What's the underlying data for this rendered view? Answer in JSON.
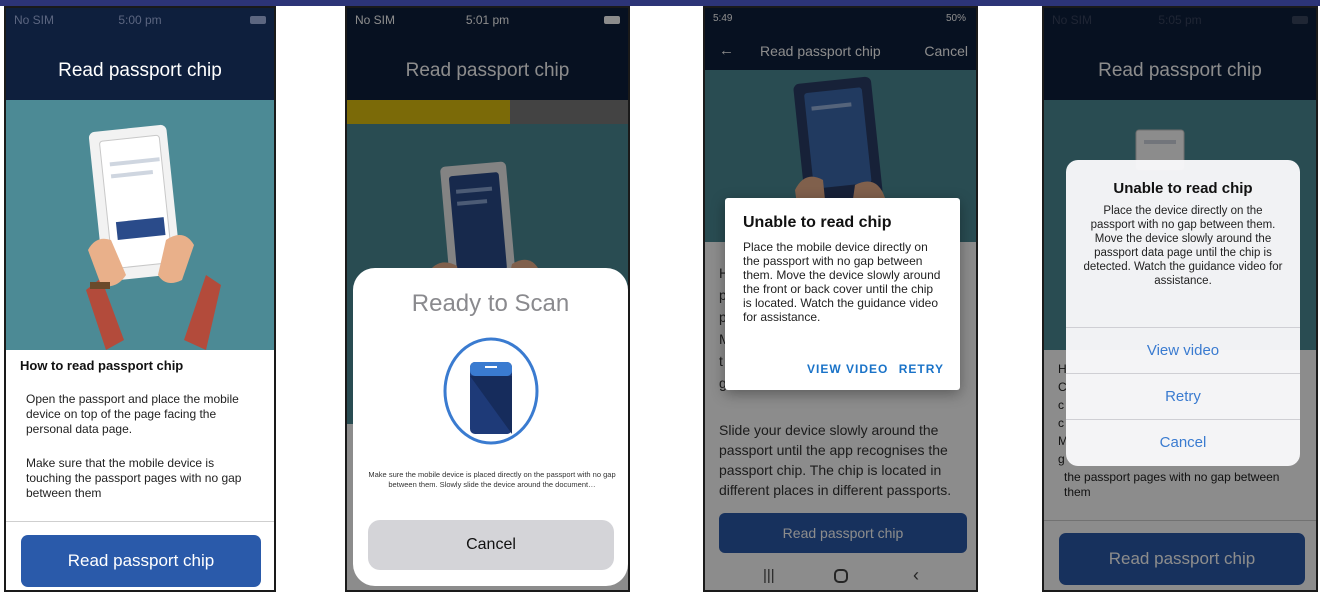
{
  "colors": {
    "navy": "#0e1f3d",
    "teal": "#4c8a95",
    "button_blue": "#2a5aaa",
    "ios_blue": "#3a7bd0",
    "android_blue": "#1a73c8"
  },
  "screen1": {
    "status": {
      "carrier": "No SIM",
      "time": "5:00 pm"
    },
    "title": "Read passport chip",
    "section_heading": "How to read passport chip",
    "paragraph1": "Open the passport and place the mobile device on top of the page facing the personal data page.",
    "paragraph2": "Make sure that the mobile device is touching the passport pages with no gap between them",
    "button": "Read passport chip"
  },
  "screen2": {
    "status": {
      "carrier": "No SIM",
      "time": "5:01 pm"
    },
    "title": "Read passport chip",
    "progress": 0.58,
    "sheet_title": "Ready to Scan",
    "instruction": "Make sure the mobile device is placed directly on the passport with no gap between them. Slowly slide the device around the document…",
    "cancel": "Cancel"
  },
  "screen3": {
    "status": {
      "time": "5:49",
      "right": "50%"
    },
    "toolbar_title": "Read passport chip",
    "toolbar_cancel": "Cancel",
    "dialog_title": "Unable to read chip",
    "dialog_message": "Place the mobile device directly on the passport with no gap between them. Move the device slowly around the front or back cover until the chip is located. Watch the guidance video for assistance.",
    "view_video": "VIEW VIDEO",
    "retry": "RETRY",
    "body_text": "Slide your device slowly around the passport until the app recognises the passport chip. The chip is located in different places in different passports.",
    "button": "Read passport chip",
    "peek_letters": [
      "H",
      "p",
      "p",
      "M",
      "t",
      "g"
    ]
  },
  "screen4": {
    "status": {
      "carrier": "No SIM",
      "time": "5:05 pm"
    },
    "title": "Read passport chip",
    "alert_title": "Unable to read chip",
    "alert_message": "Place the device directly on the passport with no gap between them. Move the device slowly around the passport data page until the chip is detected. Watch the guidance video for assistance.",
    "options": [
      "View video",
      "Retry",
      "Cancel"
    ],
    "body_text": "the passport pages with no gap between them",
    "button": "Read passport chip",
    "peek_letters": [
      "H",
      "C",
      "c",
      "c",
      "M",
      "g"
    ]
  }
}
